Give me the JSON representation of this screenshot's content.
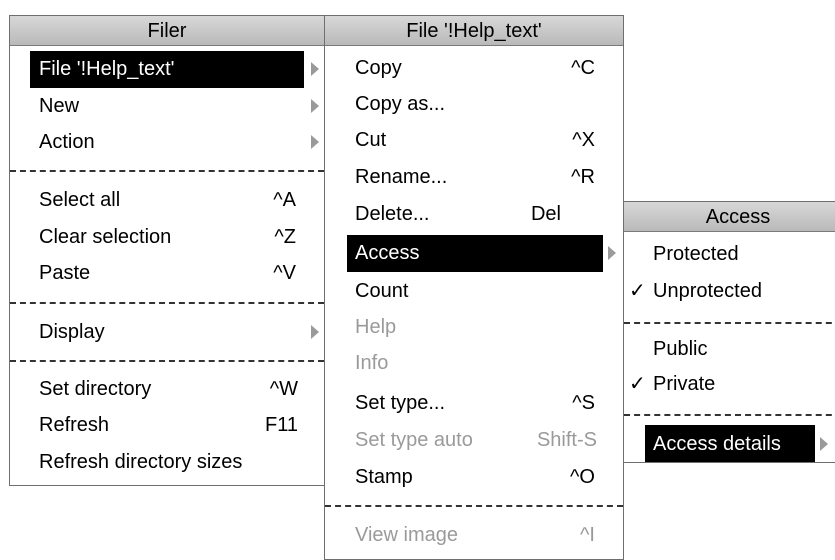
{
  "filer_menu": {
    "title": "Filer",
    "items": [
      {
        "label": "File '!Help_text'",
        "shortcut": "",
        "submenu": true
      },
      {
        "label": "New",
        "shortcut": "",
        "submenu": true
      },
      {
        "label": "Action",
        "shortcut": "",
        "submenu": true
      },
      {
        "label": "Select all",
        "shortcut": "^A"
      },
      {
        "label": "Clear selection",
        "shortcut": "^Z"
      },
      {
        "label": "Paste",
        "shortcut": "^V"
      },
      {
        "label": "Display",
        "shortcut": "",
        "submenu": true
      },
      {
        "label": "Set directory",
        "shortcut": "^W"
      },
      {
        "label": "Refresh",
        "shortcut": "F11"
      },
      {
        "label": "Refresh directory sizes",
        "shortcut": ""
      }
    ]
  },
  "file_menu": {
    "title": "File '!Help_text'",
    "items": [
      {
        "label": "Copy",
        "shortcut": "^C"
      },
      {
        "label": "Copy as...",
        "shortcut": ""
      },
      {
        "label": "Cut",
        "shortcut": "^X"
      },
      {
        "label": "Rename...",
        "shortcut": "^R"
      },
      {
        "label": "Delete...",
        "shortcut": "Del"
      },
      {
        "label": "Access",
        "shortcut": "",
        "submenu": true
      },
      {
        "label": "Count",
        "shortcut": ""
      },
      {
        "label": "Help",
        "shortcut": "",
        "disabled": true
      },
      {
        "label": "Info",
        "shortcut": "",
        "disabled": true
      },
      {
        "label": "Set type...",
        "shortcut": "^S"
      },
      {
        "label": "Set type auto",
        "shortcut": "Shift-S",
        "disabled": true
      },
      {
        "label": "Stamp",
        "shortcut": "^O"
      },
      {
        "label": "View image",
        "shortcut": "^I",
        "disabled": true
      }
    ]
  },
  "access_menu": {
    "title": "Access",
    "check_mark": "✓",
    "items": [
      {
        "label": "Protected",
        "checked": false
      },
      {
        "label": "Unprotected",
        "checked": true
      },
      {
        "label": "Public",
        "checked": false
      },
      {
        "label": "Private",
        "checked": true
      },
      {
        "label": "Access details",
        "submenu": true
      }
    ]
  },
  "colors": {
    "highlight": "#000000",
    "disabled_text": "#9a9a9a",
    "title_bar": "#c8c8c8"
  }
}
